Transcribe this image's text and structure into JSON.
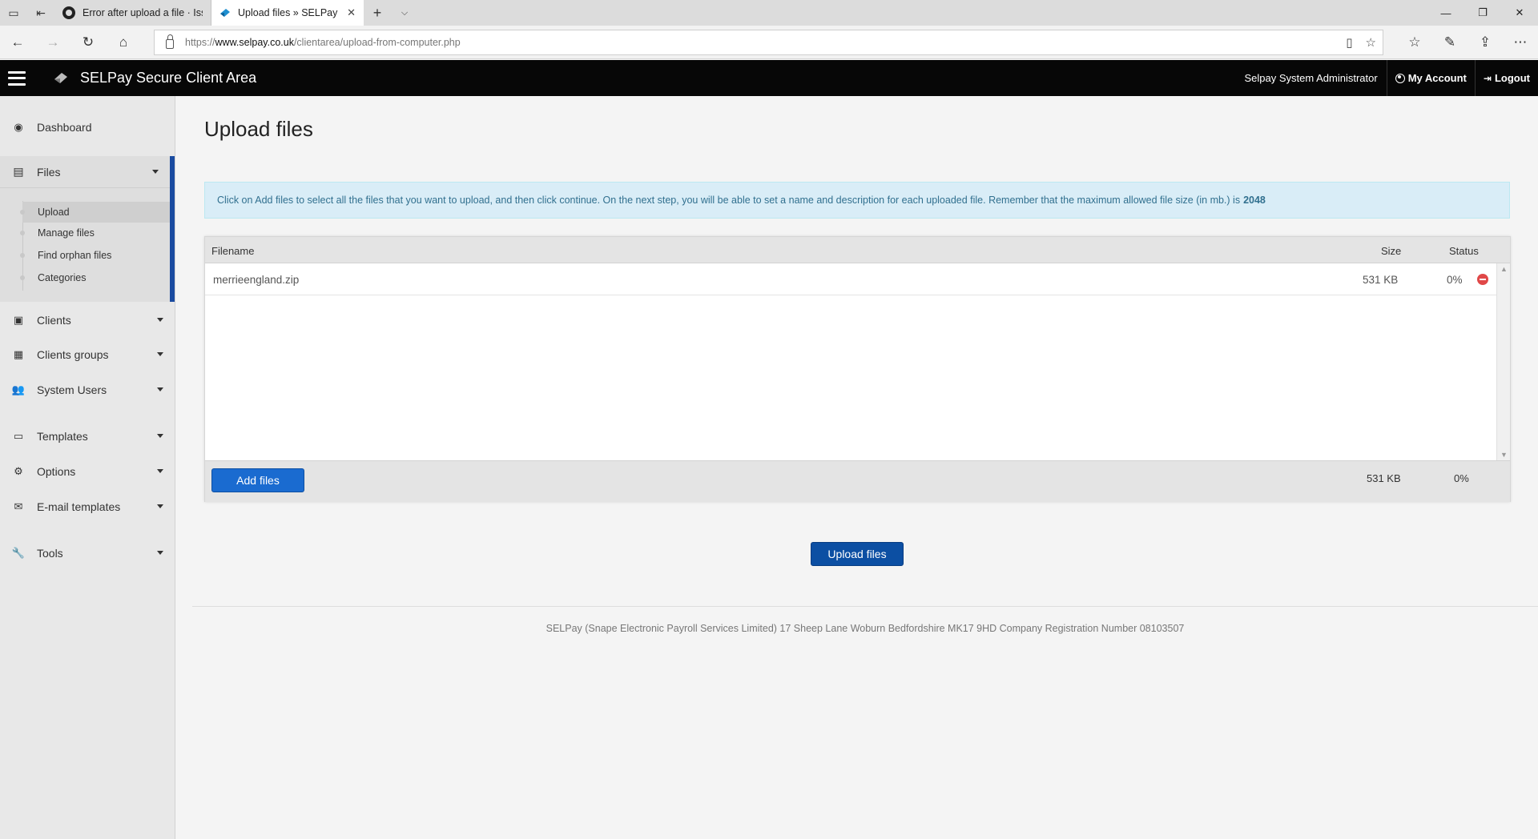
{
  "browser": {
    "tabs": [
      {
        "label": "Error after upload a file · Issu",
        "favicon": "github-icon"
      },
      {
        "label": "Upload files » SELPay Se",
        "favicon": "selpay-icon"
      }
    ],
    "new_tab_glyph": "+",
    "url_scheme": "https://",
    "url_host": "www.selpay.co.uk",
    "url_path": "/clientarea/upload-from-computer.php"
  },
  "header": {
    "title": "SELPay Secure Client Area",
    "user": "Selpay System Administrator",
    "my_account": "My Account",
    "logout": "Logout"
  },
  "sidebar": {
    "dashboard": "Dashboard",
    "files": "Files",
    "files_sub": [
      "Upload",
      "Manage files",
      "Find orphan files",
      "Categories"
    ],
    "clients": "Clients",
    "clients_groups": "Clients groups",
    "system_users": "System Users",
    "templates": "Templates",
    "options": "Options",
    "email_templates": "E-mail templates",
    "tools": "Tools"
  },
  "main": {
    "title": "Upload files",
    "info_text": "Click on Add files to select all the files that you want to upload, and then click continue. On the next step, you will be able to set a name and description for each uploaded file. Remember that the maximum allowed file size (in mb.) is",
    "info_max": "2048",
    "columns": {
      "filename": "Filename",
      "size": "Size",
      "status": "Status"
    },
    "file": {
      "name": "merrieengland.zip",
      "size": "531 KB",
      "status": "0%"
    },
    "total_size": "531 KB",
    "total_status": "0%",
    "add_files": "Add files",
    "upload_files": "Upload files"
  },
  "footer": {
    "text": "SELPay (Snape Electronic Payroll Services Limited) 17 Sheep Lane Woburn Bedfordshire MK17 9HD Company Registration Number 08103507"
  },
  "colors": {
    "accent": "#1a4ba0",
    "button_primary": "#1a6bd0",
    "info_bg": "#d9edf7",
    "info_text": "#31708f"
  }
}
